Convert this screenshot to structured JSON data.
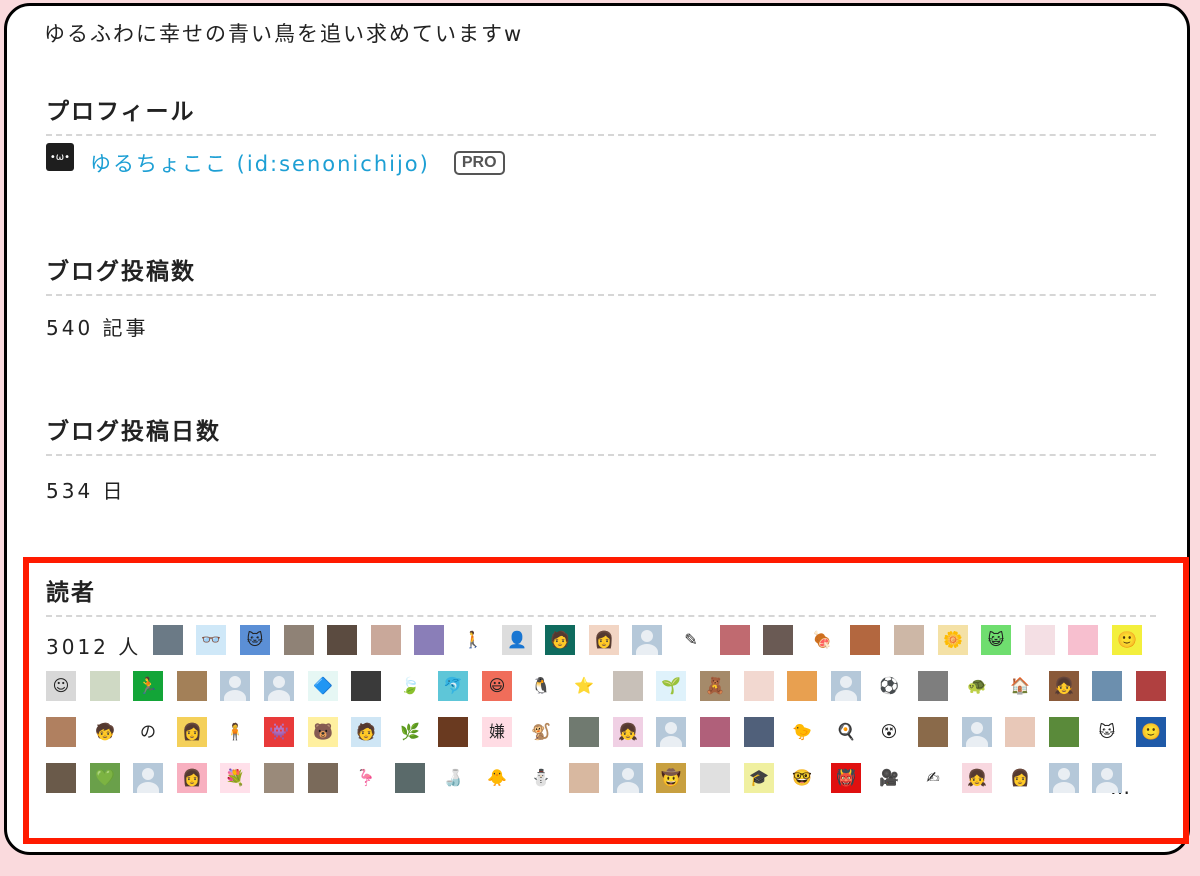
{
  "tagline": "ゆるふわに幸せの青い鳥を追い求めていますw",
  "profile": {
    "heading": "プロフィール",
    "avatar_face": "•ω•",
    "name": "ゆるちょここ (id:senonichijo)",
    "badge": "PRO"
  },
  "posts": {
    "heading": "ブログ投稿数",
    "value": "540 記事"
  },
  "days": {
    "heading": "ブログ投稿日数",
    "value": "534 日"
  },
  "readers": {
    "heading": "読者",
    "count": "3012 人",
    "more": "…",
    "icons": [
      {
        "name": "reader-photo-icon",
        "bg": "#6b7a86",
        "glyph": ""
      },
      {
        "name": "reader-glasses-icon",
        "bg": "#cfe8f8",
        "glyph": "👓"
      },
      {
        "name": "reader-cat-icon",
        "bg": "#5b8fd6",
        "glyph": "🐱"
      },
      {
        "name": "reader-cat-photo-icon",
        "bg": "#8f8276",
        "glyph": ""
      },
      {
        "name": "reader-man-photo-icon",
        "bg": "#5b4b40",
        "glyph": ""
      },
      {
        "name": "reader-woman-photo-icon",
        "bg": "#c9a89a",
        "glyph": ""
      },
      {
        "name": "reader-dvd-icon",
        "bg": "#8a7eb8",
        "glyph": ""
      },
      {
        "name": "reader-figure-icon",
        "bg": "#ffffff",
        "glyph": "🚶"
      },
      {
        "name": "reader-anime-icon",
        "bg": "#dddddd",
        "glyph": "👤"
      },
      {
        "name": "reader-glasses-man-icon",
        "bg": "#0f6b5e",
        "glyph": "🧑"
      },
      {
        "name": "reader-woman-icon",
        "bg": "#f2d5c4",
        "glyph": "👩"
      },
      {
        "name": "reader-default-icon",
        "bg": "default",
        "glyph": ""
      },
      {
        "name": "reader-sketch-icon",
        "bg": "#ffffff",
        "glyph": "✎"
      },
      {
        "name": "reader-flower-icon",
        "bg": "#c06a70",
        "glyph": ""
      },
      {
        "name": "reader-room-icon",
        "bg": "#6a5a54",
        "glyph": ""
      },
      {
        "name": "reader-stomach-icon",
        "bg": "#ffffff",
        "glyph": "🍖"
      },
      {
        "name": "reader-girl-photo-icon",
        "bg": "#b3673f",
        "glyph": ""
      },
      {
        "name": "reader-face-photo-icon",
        "bg": "#cdb7a6",
        "glyph": ""
      },
      {
        "name": "reader-yellow-flower-icon",
        "bg": "#f4e1a6",
        "glyph": "🌼"
      },
      {
        "name": "reader-green-cat-icon",
        "bg": "#6fde6f",
        "glyph": "😺"
      },
      {
        "name": "reader-pink-icon",
        "bg": "#f4dfe4",
        "glyph": ""
      },
      {
        "name": "reader-pink-girl-icon",
        "bg": "#f7bfcf",
        "glyph": ""
      },
      {
        "name": "reader-yellow-face-icon",
        "bg": "#f3ef3d",
        "glyph": "🙂"
      },
      {
        "name": "reader-gray-face-icon",
        "bg": "#d8d8d8",
        "glyph": "☺"
      },
      {
        "name": "reader-plant-icon",
        "bg": "#cfd9c4",
        "glyph": ""
      },
      {
        "name": "reader-exit-icon",
        "bg": "#13a538",
        "glyph": "🏃"
      },
      {
        "name": "reader-camel-icon",
        "bg": "#a38058",
        "glyph": ""
      },
      {
        "name": "reader-default-icon",
        "bg": "default",
        "glyph": ""
      },
      {
        "name": "reader-default-icon",
        "bg": "default",
        "glyph": ""
      },
      {
        "name": "reader-blue-logo-icon",
        "bg": "#e6f7f4",
        "glyph": "🔷"
      },
      {
        "name": "reader-man-bw-icon",
        "bg": "#3a3a3a",
        "glyph": ""
      },
      {
        "name": "reader-leaf-icon",
        "bg": "#ffffff",
        "glyph": "🍃"
      },
      {
        "name": "reader-dolphin-icon",
        "bg": "#5ec6d8",
        "glyph": "🐬"
      },
      {
        "name": "reader-crayon-icon",
        "bg": "#f06d5a",
        "glyph": "😃"
      },
      {
        "name": "reader-penguin-icon",
        "bg": "#ffffff",
        "glyph": "🐧"
      },
      {
        "name": "reader-star-icon",
        "bg": "#ffffff",
        "glyph": "⭐"
      },
      {
        "name": "reader-book-photo-icon",
        "bg": "#c8c0b8",
        "glyph": ""
      },
      {
        "name": "reader-plant-pot-icon",
        "bg": "#dff2fb",
        "glyph": "🌱"
      },
      {
        "name": "reader-teddy-icon",
        "bg": "#a58a6a",
        "glyph": "🧸"
      },
      {
        "name": "reader-cherry-icon",
        "bg": "#f2d8d0",
        "glyph": ""
      },
      {
        "name": "reader-sunset-icon",
        "bg": "#e8a050",
        "glyph": ""
      },
      {
        "name": "reader-default-icon",
        "bg": "default",
        "glyph": ""
      },
      {
        "name": "reader-soccer-icon",
        "bg": "#ffffff",
        "glyph": "⚽"
      },
      {
        "name": "reader-glasses-photo-icon",
        "bg": "#7e7e7e",
        "glyph": ""
      },
      {
        "name": "reader-turtle-icon",
        "bg": "#ffffff",
        "glyph": "🐢"
      },
      {
        "name": "reader-house-icon",
        "bg": "#ffffff",
        "glyph": "🏠"
      },
      {
        "name": "reader-girl-frame-icon",
        "bg": "#8a5a3a",
        "glyph": "👧"
      },
      {
        "name": "reader-building-icon",
        "bg": "#6c8fae",
        "glyph": ""
      },
      {
        "name": "reader-red-photo-icon",
        "bg": "#b04040",
        "glyph": ""
      },
      {
        "name": "reader-pink-flower-photo-icon",
        "bg": "#b08060",
        "glyph": ""
      },
      {
        "name": "reader-boy-icon",
        "bg": "#ffffff",
        "glyph": "🧒"
      },
      {
        "name": "reader-no-icon",
        "bg": "#ffffff",
        "glyph": "の"
      },
      {
        "name": "reader-long-hair-icon",
        "bg": "#f4d05a",
        "glyph": "👩"
      },
      {
        "name": "reader-kid-icon",
        "bg": "#ffffff",
        "glyph": "🧍"
      },
      {
        "name": "reader-red-monster-icon",
        "bg": "#e83a3a",
        "glyph": "👾"
      },
      {
        "name": "reader-bear-icon",
        "bg": "#fff0a0",
        "glyph": "🐻"
      },
      {
        "name": "reader-stripe-icon",
        "bg": "#cfe6f5",
        "glyph": "🧑"
      },
      {
        "name": "reader-green-circle-icon",
        "bg": "#ffffff",
        "glyph": "🌿"
      },
      {
        "name": "reader-dog-photo-icon",
        "bg": "#6a3a20",
        "glyph": ""
      },
      {
        "name": "reader-kanji-icon",
        "bg": "#ffdce4",
        "glyph": "嫌"
      },
      {
        "name": "reader-monkey-icon",
        "bg": "#ffffff",
        "glyph": "🐒"
      },
      {
        "name": "reader-cat-round-icon",
        "bg": "#707a70",
        "glyph": ""
      },
      {
        "name": "reader-pastel-girl-icon",
        "bg": "#f0d0e4",
        "glyph": "👧"
      },
      {
        "name": "reader-default-icon",
        "bg": "default",
        "glyph": ""
      },
      {
        "name": "reader-cherry-blossom-icon",
        "bg": "#b0607a",
        "glyph": ""
      },
      {
        "name": "reader-lake-icon",
        "bg": "#50607a",
        "glyph": ""
      },
      {
        "name": "reader-chick-icon",
        "bg": "#ffffff",
        "glyph": "🐤"
      },
      {
        "name": "reader-egg-icon",
        "bg": "#ffffff",
        "glyph": "🍳"
      },
      {
        "name": "reader-ghost-icon",
        "bg": "#ffffff",
        "glyph": "😵"
      },
      {
        "name": "reader-desk-photo-icon",
        "bg": "#8a6a4a",
        "glyph": ""
      },
      {
        "name": "reader-default-icon",
        "bg": "default",
        "glyph": ""
      },
      {
        "name": "reader-girl-face-icon",
        "bg": "#e8c8b8",
        "glyph": ""
      },
      {
        "name": "reader-forest-icon",
        "bg": "#5a8a3a",
        "glyph": ""
      },
      {
        "name": "reader-cat-white-icon",
        "bg": "#ffffff",
        "glyph": "🐱"
      },
      {
        "name": "reader-blue-man-icon",
        "bg": "#1f5aa8",
        "glyph": "🙂"
      },
      {
        "name": "reader-face-bw-icon",
        "bg": "#6a5a4a",
        "glyph": ""
      },
      {
        "name": "reader-green-heart-icon",
        "bg": "#6aa04a",
        "glyph": "💚"
      },
      {
        "name": "reader-default-icon",
        "bg": "default",
        "glyph": ""
      },
      {
        "name": "reader-pink-hair-icon",
        "bg": "#f8b0c0",
        "glyph": "👩"
      },
      {
        "name": "reader-bouquet-icon",
        "bg": "#ffe0ea",
        "glyph": "💐"
      },
      {
        "name": "reader-man-doorway-icon",
        "bg": "#9a8a7a",
        "glyph": ""
      },
      {
        "name": "reader-street-icon",
        "bg": "#7a6a5a",
        "glyph": ""
      },
      {
        "name": "reader-dancer-icon",
        "bg": "#ffffff",
        "glyph": "🦩"
      },
      {
        "name": "reader-office-icon",
        "bg": "#5a6a6a",
        "glyph": ""
      },
      {
        "name": "reader-bottles-icon",
        "bg": "#ffffff",
        "glyph": "🍶"
      },
      {
        "name": "reader-yellow-bird-icon",
        "bg": "#ffffff",
        "glyph": "🐥"
      },
      {
        "name": "reader-snowman-icon",
        "bg": "#ffffff",
        "glyph": "⛄"
      },
      {
        "name": "reader-young-man-icon",
        "bg": "#d8b8a0",
        "glyph": ""
      },
      {
        "name": "reader-default-icon",
        "bg": "default",
        "glyph": ""
      },
      {
        "name": "reader-lego-icon",
        "bg": "#c8a040",
        "glyph": "🤠"
      },
      {
        "name": "reader-sketch-face-icon",
        "bg": "#e0e0e0",
        "glyph": ""
      },
      {
        "name": "reader-graduate-icon",
        "bg": "#f0f0a0",
        "glyph": "🎓"
      },
      {
        "name": "reader-glasses-boy-icon",
        "bg": "#ffffff",
        "glyph": "🤓"
      },
      {
        "name": "reader-red-mask-icon",
        "bg": "#e01010",
        "glyph": "👹"
      },
      {
        "name": "reader-camera-icon",
        "bg": "#ffffff",
        "glyph": "🎥"
      },
      {
        "name": "reader-line-art-icon",
        "bg": "#ffffff",
        "glyph": "✍"
      },
      {
        "name": "reader-cute-girl-icon",
        "bg": "#f8d8e0",
        "glyph": "👧"
      },
      {
        "name": "reader-bob-hair-icon",
        "bg": "#ffffff",
        "glyph": "👩"
      },
      {
        "name": "reader-default-icon",
        "bg": "default",
        "glyph": ""
      },
      {
        "name": "reader-default-icon",
        "bg": "default",
        "glyph": ""
      }
    ]
  }
}
